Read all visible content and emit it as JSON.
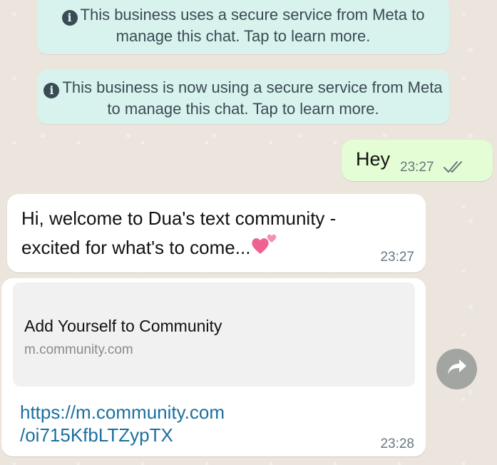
{
  "system_messages": [
    {
      "icon": "info-icon",
      "text": "This business uses a secure service from Meta to manage this chat. Tap to learn more."
    },
    {
      "icon": "info-icon",
      "text": "This business is now using a secure service from Meta to manage this chat. Tap to learn more."
    }
  ],
  "outgoing_message": {
    "text": "Hey",
    "time": "23:27",
    "status_icon": "double-check-icon"
  },
  "incoming_messages": [
    {
      "text": "Hi, welcome to Dua's text community - excited for what's to come...",
      "emoji_icon": "two-hearts-icon",
      "time": "23:27"
    },
    {
      "preview_title": "Add Yourself to Community",
      "preview_domain": "m.community.com",
      "link_line1": "https://m.community.com",
      "link_line2": "/oi715KfbLTZypTX",
      "time": "23:28"
    }
  ],
  "forward_button": {
    "icon": "forward-arrow-icon"
  },
  "colors": {
    "chat_background": "#ece5dd",
    "system_bubble": "#d8f3ee",
    "outgoing_bubble": "#e4fdd4",
    "incoming_bubble": "#ffffff",
    "link": "#1b6fa0",
    "timestamp": "#667781"
  }
}
